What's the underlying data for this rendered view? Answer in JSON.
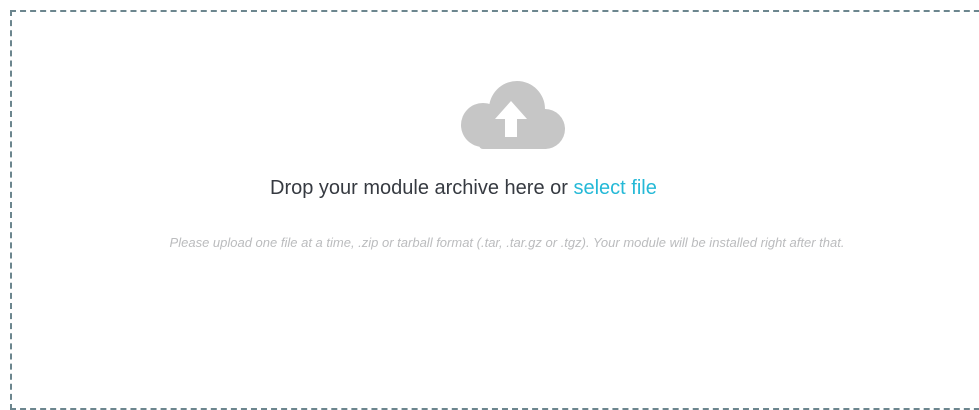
{
  "dropzone": {
    "icon": "cloud-upload-icon",
    "icon_color": "#c6c6c6",
    "border_color": "#6c868e",
    "headline_prefix": "Drop your module archive here or",
    "select_link": "select file",
    "link_color": "#25b9d7",
    "help_text": "Please upload one file at a time, .zip or tarball format (.tar, .tar.gz or .tgz). Your module will be installed right after that."
  }
}
